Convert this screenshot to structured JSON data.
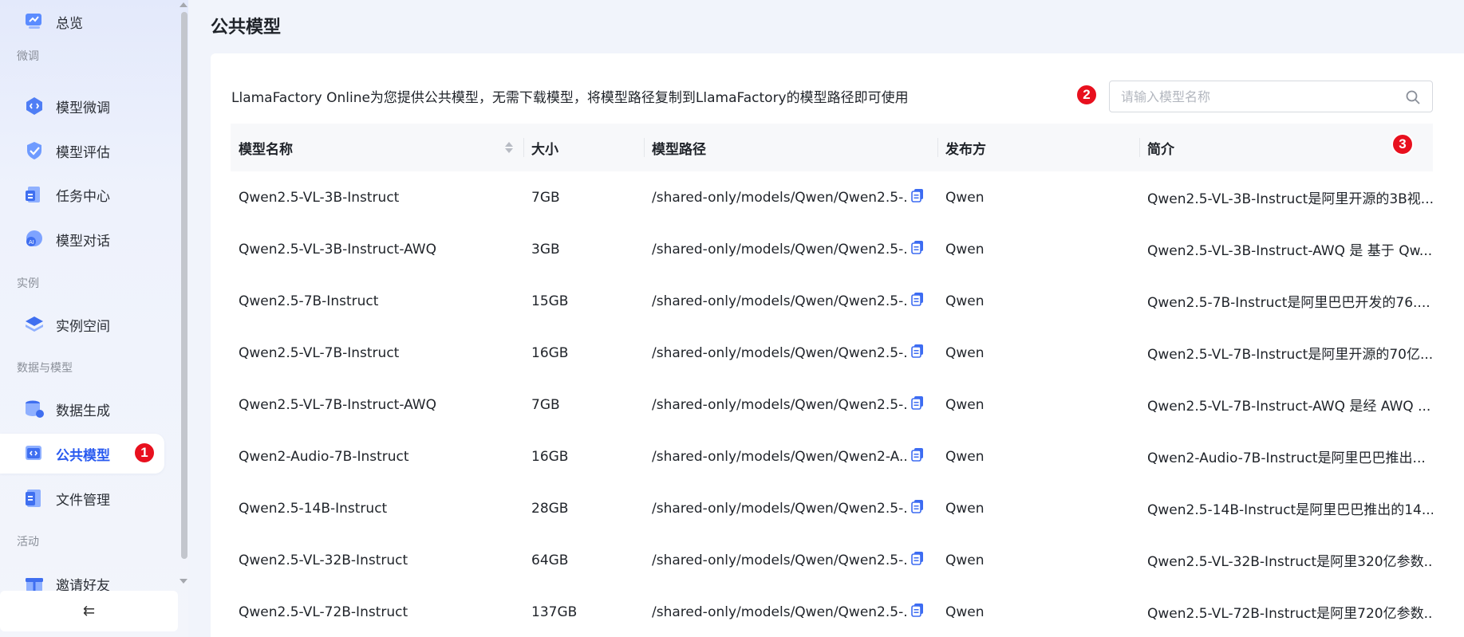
{
  "sidebar": {
    "items": [
      {
        "label": "总览",
        "icon": "overview-icon"
      },
      {
        "label": "模型微调",
        "icon": "finetune-icon"
      },
      {
        "label": "模型评估",
        "icon": "evaluate-icon"
      },
      {
        "label": "任务中心",
        "icon": "tasks-icon"
      },
      {
        "label": "模型对话",
        "icon": "chat-icon"
      },
      {
        "label": "实例空间",
        "icon": "layers-icon"
      },
      {
        "label": "数据生成",
        "icon": "database-icon"
      },
      {
        "label": "公共模型",
        "icon": "code-window-icon"
      },
      {
        "label": "文件管理",
        "icon": "file-icon"
      },
      {
        "label": "邀请好友",
        "icon": "gift-icon"
      }
    ],
    "sections": [
      "微调",
      "实例",
      "数据与模型",
      "活动"
    ],
    "collapse_icon": "⇇"
  },
  "badges": [
    "1",
    "2",
    "3"
  ],
  "page": {
    "title": "公共模型",
    "description": "LlamaFactory Online为您提供公共模型，无需下载模型，将模型路径复制到LlamaFactory的模型路径即可使用",
    "search_placeholder": "请输入模型名称"
  },
  "table": {
    "headers": [
      "模型名称",
      "大小",
      "模型路径",
      "发布方",
      "简介"
    ],
    "rows": [
      {
        "name": "Qwen2.5-VL-3B-Instruct",
        "size": "7GB",
        "path": "/shared-only/models/Qwen/Qwen2.5-...",
        "publisher": "Qwen",
        "intro": "Qwen2.5-VL-3B-Instruct是阿里开源的3B视..."
      },
      {
        "name": "Qwen2.5-VL-3B-Instruct-AWQ",
        "size": "3GB",
        "path": "/shared-only/models/Qwen/Qwen2.5-...",
        "publisher": "Qwen",
        "intro": "Qwen2.5-VL-3B-Instruct-AWQ 是 基于 Qw..."
      },
      {
        "name": "Qwen2.5-7B-Instruct",
        "size": "15GB",
        "path": "/shared-only/models/Qwen/Qwen2.5-...",
        "publisher": "Qwen",
        "intro": "Qwen2.5-7B-Instruct是阿里巴巴开发的76...."
      },
      {
        "name": "Qwen2.5-VL-7B-Instruct",
        "size": "16GB",
        "path": "/shared-only/models/Qwen/Qwen2.5-...",
        "publisher": "Qwen",
        "intro": "Qwen2.5-VL-7B-Instruct是阿里开源的70亿..."
      },
      {
        "name": "Qwen2.5-VL-7B-Instruct-AWQ",
        "size": "7GB",
        "path": "/shared-only/models/Qwen/Qwen2.5-...",
        "publisher": "Qwen",
        "intro": "Qwen2.5-VL-7B-Instruct-AWQ 是经 AWQ ..."
      },
      {
        "name": "Qwen2-Audio-7B-Instruct",
        "size": "16GB",
        "path": "/shared-only/models/Qwen/Qwen2-A...",
        "publisher": "Qwen",
        "intro": "Qwen2-Audio-7B-Instruct是阿里巴巴推出..."
      },
      {
        "name": "Qwen2.5-14B-Instruct",
        "size": "28GB",
        "path": "/shared-only/models/Qwen/Qwen2.5-...",
        "publisher": "Qwen",
        "intro": "Qwen2.5-14B-Instruct是阿里巴巴推出的14..."
      },
      {
        "name": "Qwen2.5-VL-32B-Instruct",
        "size": "64GB",
        "path": "/shared-only/models/Qwen/Qwen2.5-...",
        "publisher": "Qwen",
        "intro": "Qwen2.5-VL-32B-Instruct是阿里320亿参数..."
      },
      {
        "name": "Qwen2.5-VL-72B-Instruct",
        "size": "137GB",
        "path": "/shared-only/models/Qwen/Qwen2.5-...",
        "publisher": "Qwen",
        "intro": "Qwen2.5-VL-72B-Instruct是阿里720亿参数..."
      }
    ]
  },
  "colors": {
    "accent": "#2a5bf0",
    "badge": "#e8101e",
    "copy_icon": "#3d6cf2"
  }
}
